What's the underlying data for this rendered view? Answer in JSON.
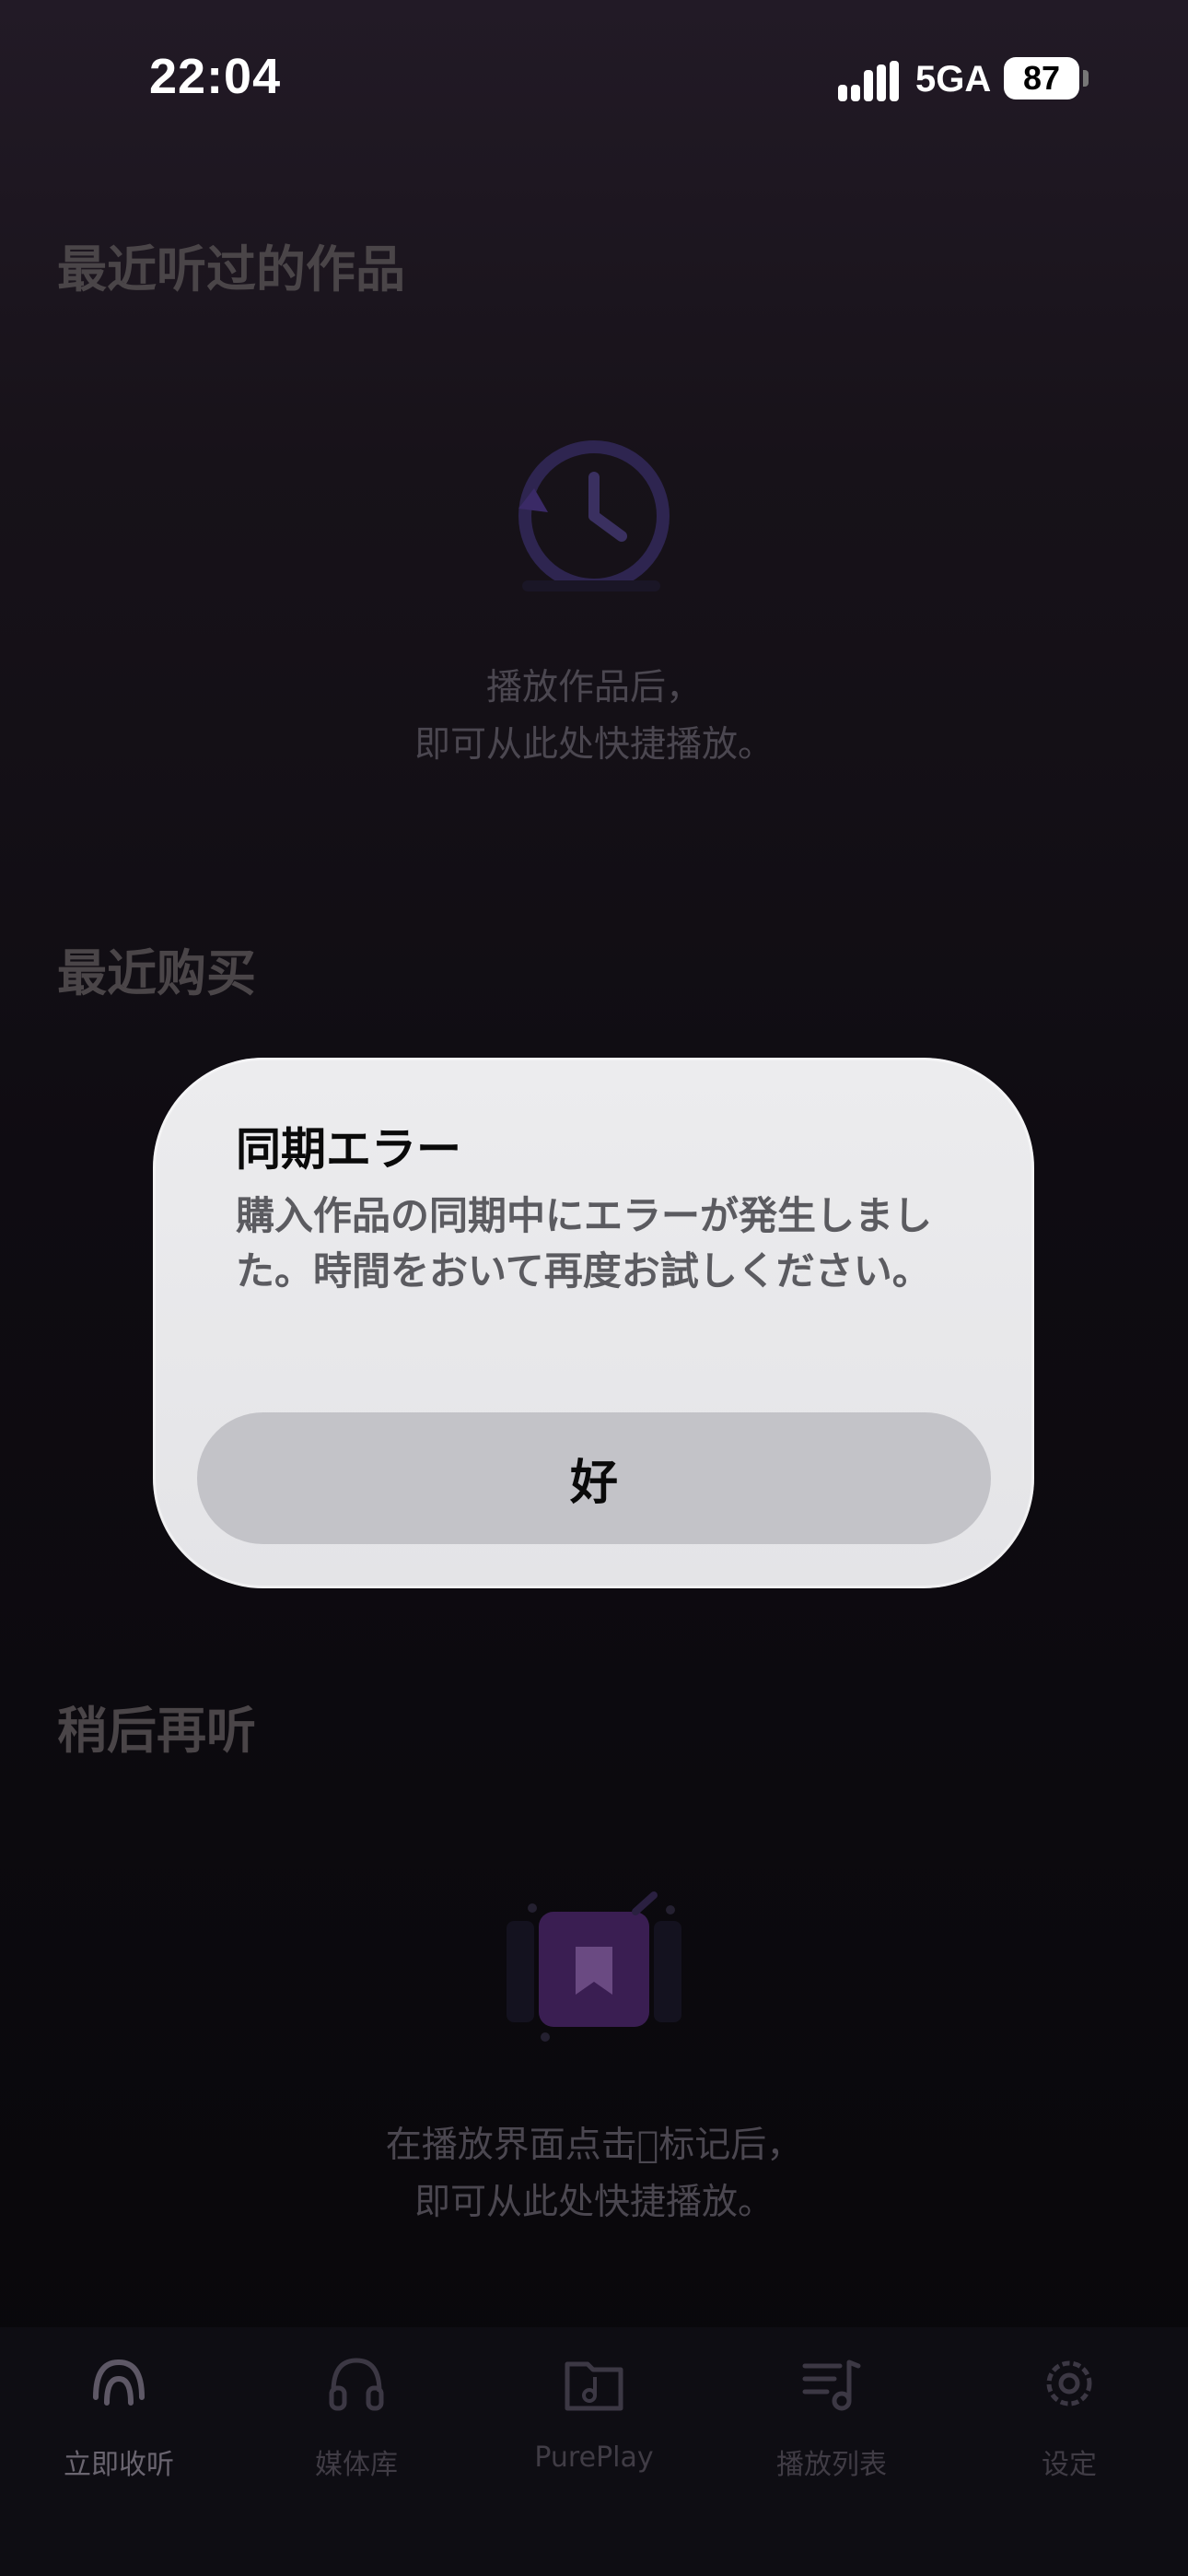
{
  "status_bar": {
    "time": "22:04",
    "network": "5GA",
    "battery": "87"
  },
  "sections": {
    "recent_listened": {
      "title": "最近听过的作品",
      "empty_line1": "播放作品后，",
      "empty_line2": "即可从此处快捷播放。"
    },
    "recent_purchases": {
      "title": "最近购买"
    },
    "listen_later": {
      "title": "稍后再听",
      "empty_line1": "在播放界面点击􀉟标记后，",
      "empty_line2": "即可从此处快捷播放。"
    }
  },
  "alert": {
    "title": "同期エラー",
    "message": "購入作品の同期中にエラーが発生しました。時間をおいて再度お試しください。",
    "button_label": "好"
  },
  "tabs": [
    {
      "label": "立即收听",
      "icon": "headphone-arc-icon",
      "active": true
    },
    {
      "label": "媒体库",
      "icon": "headphones-icon",
      "active": false
    },
    {
      "label": "PurePlay",
      "icon": "music-folder-icon",
      "active": false
    },
    {
      "label": "播放列表",
      "icon": "playlist-icon",
      "active": false
    },
    {
      "label": "设定",
      "icon": "gear-icon",
      "active": false
    }
  ],
  "colors": {
    "accent_purple": "#5a2a7a",
    "alert_bg": "#e8e8ea",
    "alert_button": "#c3c3c8"
  }
}
